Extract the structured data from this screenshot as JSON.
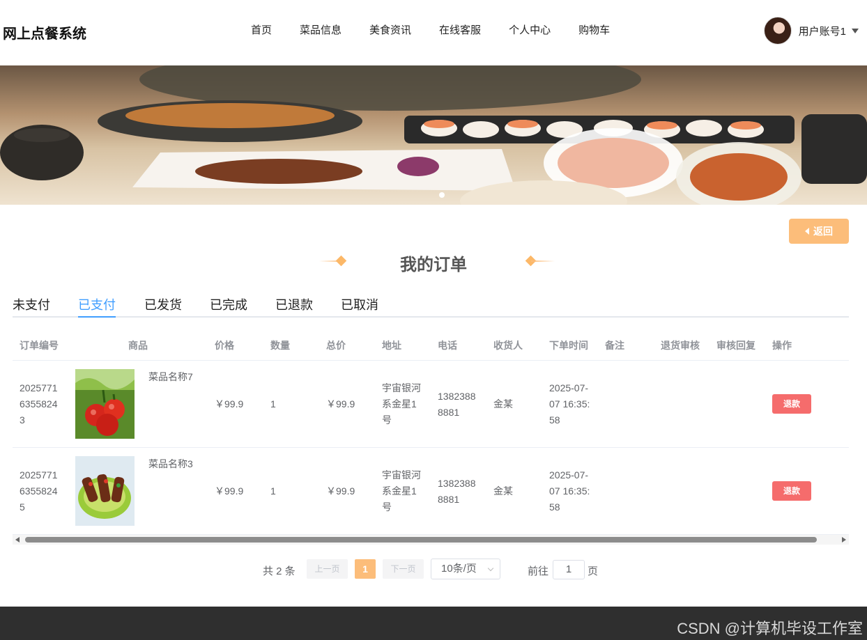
{
  "header": {
    "logo": "网上点餐系统",
    "nav": [
      "首页",
      "菜品信息",
      "美食资讯",
      "在线客服",
      "个人中心",
      "购物车"
    ],
    "user_name": "用户账号1"
  },
  "back_label": "返回",
  "page_title": "我的订单",
  "tabs": [
    "未支付",
    "已支付",
    "已发货",
    "已完成",
    "已退款",
    "已取消"
  ],
  "active_tab": "已支付",
  "table": {
    "headers": [
      "订单编号",
      "商品",
      "价格",
      "数量",
      "总价",
      "地址",
      "电话",
      "收货人",
      "下单时间",
      "备注",
      "退货审核",
      "审核回复",
      "操作"
    ],
    "rows": [
      {
        "order_no": [
          "2025771",
          "6355824",
          "3"
        ],
        "product": "菜品名称7",
        "price": "￥99.9",
        "qty": "1",
        "total": "￥99.9",
        "address": [
          "宇宙银河",
          "系金星1",
          "号"
        ],
        "phone": [
          "1382388",
          "8881"
        ],
        "receiver": "金某",
        "time": [
          "2025-07-",
          "07 16:35:",
          "58"
        ],
        "action": "退款"
      },
      {
        "order_no": [
          "2025771",
          "6355824",
          "5"
        ],
        "product": "菜品名称3",
        "price": "￥99.9",
        "qty": "1",
        "total": "￥99.9",
        "address": [
          "宇宙银河",
          "系金星1",
          "号"
        ],
        "phone": [
          "1382388",
          "8881"
        ],
        "receiver": "金某",
        "time": [
          "2025-07-",
          "07 16:35:",
          "58"
        ],
        "action": "退款"
      }
    ]
  },
  "pagination": {
    "total": "共 2 条",
    "prev": "上一页",
    "current": "1",
    "next": "下一页",
    "page_size": "10条/页",
    "goto_label": "前往",
    "goto_value": "1",
    "page_label": "页"
  },
  "watermark": "CSDN @计算机毕设工作室",
  "colors": {
    "accent": "#fcbd7a",
    "active_tab": "#409eff",
    "refund_button": "#f56c6c",
    "footer": "#2f2f2f"
  }
}
